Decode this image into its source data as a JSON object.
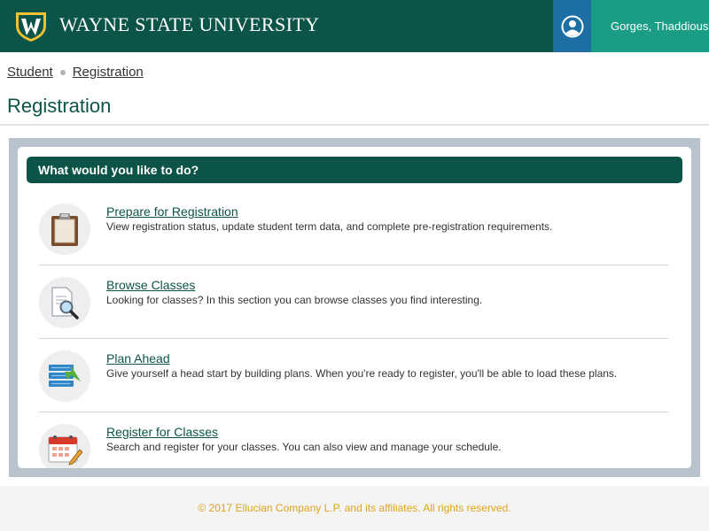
{
  "header": {
    "brand": "WAYNE STATE UNIVERSITY",
    "user_name": "Gorges, Thaddious",
    "logo_icon": "wayne-state-w-shield-icon",
    "user_icon": "user-avatar-icon",
    "colors": {
      "bar": "#0c5447",
      "user_icon_bg": "#1c6ea3",
      "user_name_bg": "#1a9c85"
    }
  },
  "breadcrumb": {
    "items": [
      "Student",
      "Registration"
    ]
  },
  "page_title": "Registration",
  "panel": {
    "header": "What would you like to do?",
    "items": [
      {
        "link": "Prepare for Registration",
        "desc": "View registration status, update student term data, and complete pre-registration requirements.",
        "icon": "clipboard-icon"
      },
      {
        "link": "Browse Classes",
        "desc": "Looking for classes? In this section you can browse classes you find interesting.",
        "icon": "magnifier-document-icon"
      },
      {
        "link": "Plan Ahead",
        "desc": "Give yourself a head start by building plans. When you're ready to register, you'll be able to load these plans.",
        "icon": "plan-list-arrow-icon"
      },
      {
        "link": "Register for Classes",
        "desc": "Search and register for your classes. You can also view and manage your schedule.",
        "icon": "calendar-pencil-icon"
      }
    ]
  },
  "footer": {
    "text": "© 2017 Ellucian Company L.P. and its affiliates. All rights reserved."
  }
}
